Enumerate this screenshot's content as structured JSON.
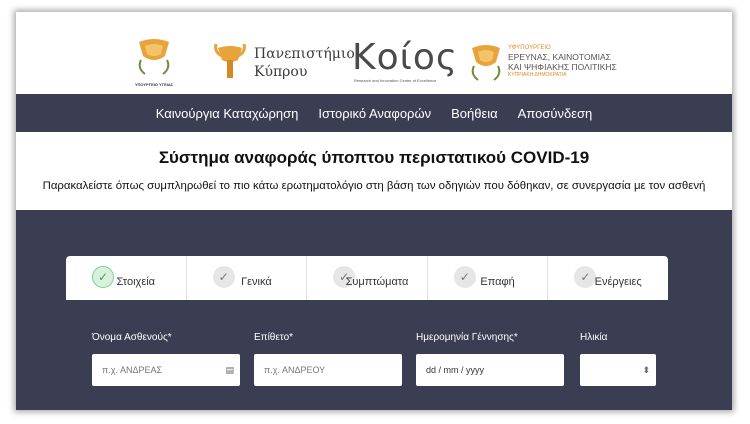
{
  "logos": {
    "moh_caption": "ΥΠΟΥΡΓΕΙΟ ΥΓΕΙΑΣ",
    "university_line1": "Πανεπιστήμιο",
    "university_line2": "Κύπρου",
    "koios_word": "Κοίος",
    "koios_subtitle": "Research and Innovation Center of Excellence",
    "dmrid_line0": "ΥΦΥΠΟΥΡΓΕΙΟ",
    "dmrid_line1": "ΕΡΕΥΝΑΣ, ΚΑΙΝΟΤΟΜΙΑΣ",
    "dmrid_line2": "ΚΑΙ ΨΗΦΙΑΚΗΣ ΠΟΛΙΤΙΚΗΣ",
    "dmrid_line3": "ΚΥΠΡΙΑΚΗ ΔΗΜΟΚΡΑΤΙΑ"
  },
  "nav": {
    "new_entry": "Καινούργια Καταχώρηση",
    "history": "Ιστορικό Αναφορών",
    "help": "Βοήθεια",
    "logout": "Αποσύνδεση"
  },
  "page": {
    "title": "Σύστημα αναφοράς ύποπτου περιστατικού COVID-19",
    "subtitle": "Παρακαλείστε όπως συμπληρωθεί το πιο κάτω ερωτηματολόγιο στη βάση των οδηγιών που δόθηκαν, σε συνεργασία με τον ασθενή"
  },
  "tabs": [
    {
      "label": "Στοιχεία",
      "active": true
    },
    {
      "label": "Γενικά",
      "active": false
    },
    {
      "label": "Συμπτώματα",
      "active": false
    },
    {
      "label": "Επαφή",
      "active": false
    },
    {
      "label": "Ενέργειες",
      "active": false
    }
  ],
  "form": {
    "first_name": {
      "label": "Όνομα Ασθενούς*",
      "placeholder": "π.χ. ΑΝΔΡΕΑΣ"
    },
    "last_name": {
      "label": "Επίθετο*",
      "placeholder": "π.χ. ΑΝΔΡΕΟΥ"
    },
    "birth_date": {
      "label": "Ημερομηνία Γέννησης*",
      "placeholder": "dd / mm / yyyy"
    },
    "age": {
      "label": "Ηλικία",
      "value": ""
    }
  },
  "colors": {
    "nav_bg": "#3b3d52",
    "active_check": "#38a552"
  },
  "icons": {
    "check": "✓",
    "contact_card": "▤",
    "spinner": "⬍"
  }
}
